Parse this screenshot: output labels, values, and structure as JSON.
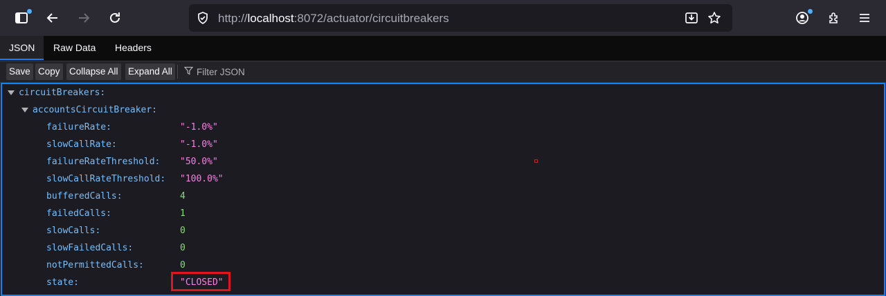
{
  "browser": {
    "url_prefix": "http://",
    "url_host": "localhost",
    "url_rest": ":8072/actuator/circuitbreakers"
  },
  "viewer": {
    "tabs": [
      {
        "label": "JSON",
        "active": true
      },
      {
        "label": "Raw Data",
        "active": false
      },
      {
        "label": "Headers",
        "active": false
      }
    ],
    "buttons": {
      "save": "Save",
      "copy": "Copy",
      "collapse_all": "Collapse All",
      "expand_all": "Expand All"
    },
    "filter_placeholder": "Filter JSON"
  },
  "tree": {
    "root_key": "circuitBreakers:",
    "child_key": "accountsCircuitBreaker:",
    "rows": [
      {
        "key": "failureRate:",
        "value": "\"-1.0%\"",
        "type": "string"
      },
      {
        "key": "slowCallRate:",
        "value": "\"-1.0%\"",
        "type": "string"
      },
      {
        "key": "failureRateThreshold:",
        "value": "\"50.0%\"",
        "type": "string"
      },
      {
        "key": "slowCallRateThreshold:",
        "value": "\"100.0%\"",
        "type": "string"
      },
      {
        "key": "bufferedCalls:",
        "value": "4",
        "type": "number"
      },
      {
        "key": "failedCalls:",
        "value": "1",
        "type": "number"
      },
      {
        "key": "slowCalls:",
        "value": "0",
        "type": "number"
      },
      {
        "key": "slowFailedCalls:",
        "value": "0",
        "type": "number"
      },
      {
        "key": "notPermittedCalls:",
        "value": "0",
        "type": "number"
      },
      {
        "key": "state:",
        "value": "\"CLOSED\"",
        "type": "string"
      }
    ]
  },
  "colors": {
    "key": "#75bfff",
    "string": "#ff7de9",
    "number": "#86de74",
    "highlight": "#e2141d",
    "accent": "#0a84ff"
  },
  "icons": [
    "sidebar-icon",
    "back-icon",
    "forward-icon",
    "reload-icon",
    "shield-icon",
    "download-icon",
    "star-icon",
    "account-icon",
    "extensions-icon",
    "menu-icon",
    "filter-icon"
  ]
}
